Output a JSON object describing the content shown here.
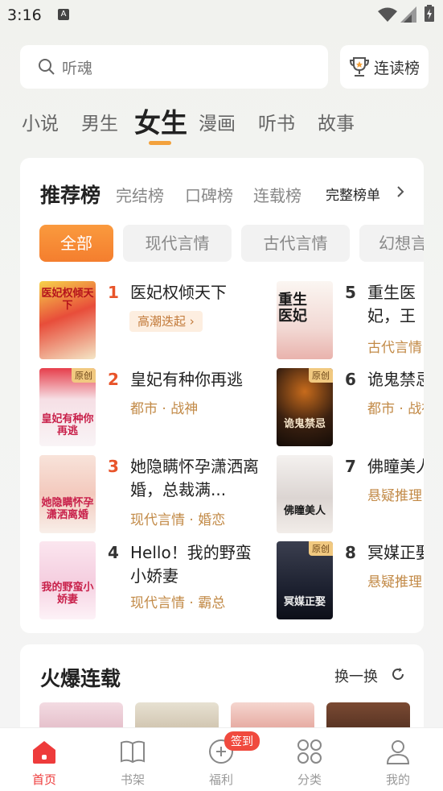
{
  "status_bar": {
    "time": "3:16"
  },
  "search": {
    "placeholder": "听魂"
  },
  "top_rank_button": {
    "label": "连读榜"
  },
  "channel_tabs": [
    "小说",
    "男生",
    "女生",
    "漫画",
    "听书",
    "故事"
  ],
  "ranking_card": {
    "title": "推荐榜",
    "subtabs": [
      "完结榜",
      "口碑榜",
      "连载榜"
    ],
    "full_list_label": "完整榜单",
    "categories": [
      "全部",
      "现代言情",
      "古代言情",
      "幻想言"
    ],
    "books_left": [
      {
        "rank": "1",
        "title": "医妃权倾天下",
        "tag": "高潮迭起",
        "cover_text": "医妃权倾天下"
      },
      {
        "rank": "2",
        "title": "皇妃有种你再逃",
        "meta": "都市 · 战神",
        "badge": "原创",
        "cover_text": "皇妃有种你再逃"
      },
      {
        "rank": "3",
        "title": "她隐瞒怀孕潇洒离婚，总裁满...",
        "meta": "现代言情 · 婚恋",
        "cover_text": "她隐瞒怀孕潇洒离婚"
      },
      {
        "rank": "4",
        "title": "Hello！我的野蛮小娇妻",
        "meta": "现代言情 · 霸总",
        "cover_text": "我的野蛮小娇妻"
      }
    ],
    "books_right": [
      {
        "rank": "5",
        "title": "重生医妃，王爷，别...",
        "meta": "古代言情",
        "cover_text": "重生医妃"
      },
      {
        "rank": "6",
        "title": "诡鬼禁忌",
        "meta": "都市 · 战神",
        "badge": "原创",
        "cover_text": "诡鬼禁忌"
      },
      {
        "rank": "7",
        "title": "佛瞳美人",
        "meta": "悬疑推理",
        "cover_text": "佛瞳美人"
      },
      {
        "rank": "8",
        "title": "冥媒正娶",
        "meta": "悬疑推理",
        "badge": "原创",
        "cover_text": "冥媒正娶"
      }
    ]
  },
  "hot_serial": {
    "title": "火爆连载",
    "swap_label": "换一换"
  },
  "bottom_nav": {
    "items": [
      "首页",
      "书架",
      "福利",
      "分类",
      "我的"
    ],
    "badge": "签到"
  },
  "colors": {
    "accent": "#f47e2e",
    "rank_red": "#e8542a",
    "nav_active": "#ee3b3b",
    "meta": "#c28a47"
  }
}
